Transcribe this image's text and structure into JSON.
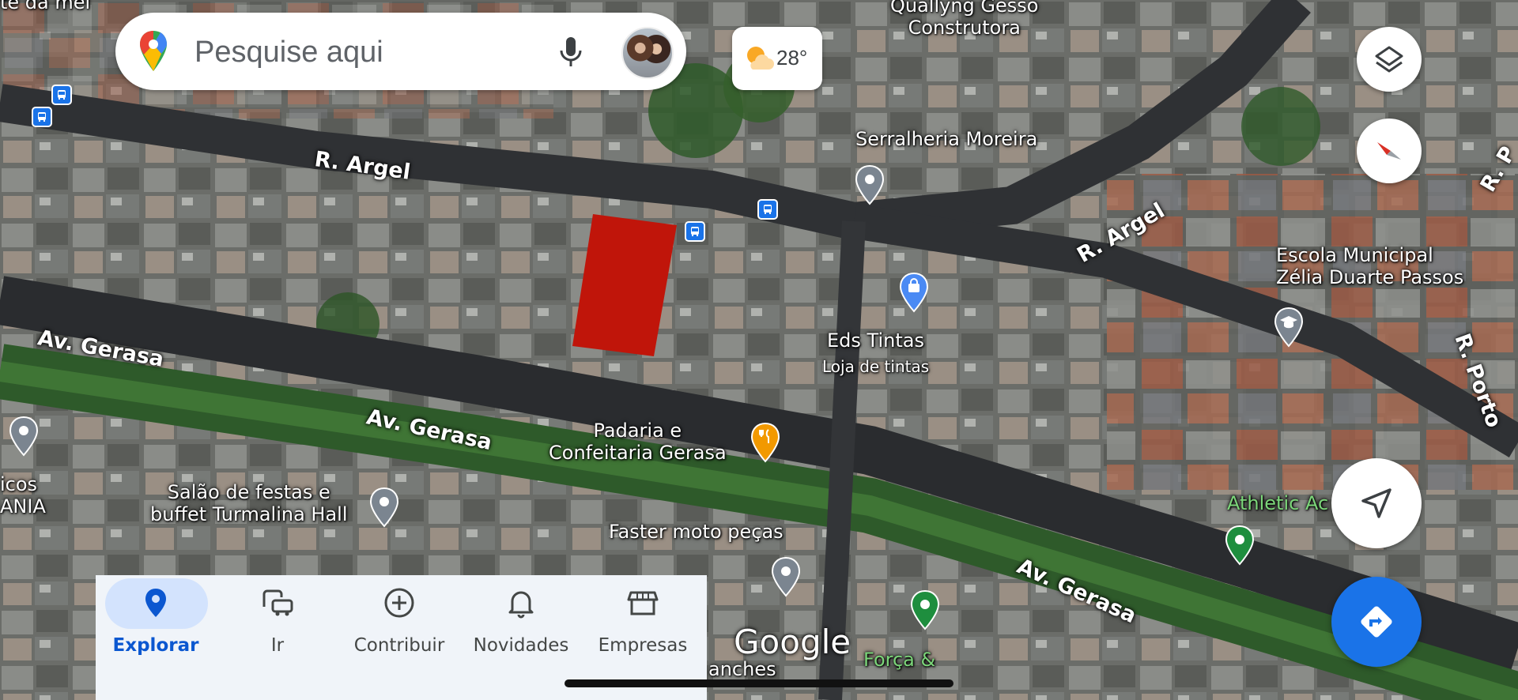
{
  "search": {
    "placeholder": "Pesquise aqui",
    "mic_icon": "mic-icon",
    "logo_icon": "maps-pin-logo-icon"
  },
  "weather": {
    "temperature": "28°",
    "icon": "partly-sunny-icon"
  },
  "streets": {
    "argel_left": "R. Argel",
    "argel_right": "R. Argel",
    "gerasa_left": "Av. Gerasa",
    "gerasa_mid": "Av. Gerasa",
    "gerasa_right": "Av. Gerasa",
    "r_porto": "R. Porto",
    "r_right": "R. P"
  },
  "places": {
    "qualyng_line1": "Quallyng Gesso",
    "qualyng_line2": "Construtora",
    "serralheria": "Serralheria Moreira",
    "escola_line1": "Escola Municipal",
    "escola_line2": "Zélia Duarte Passos",
    "eds_tintas": "Eds Tintas",
    "eds_tintas_sub": "Loja de tintas",
    "padaria_line1": "Padaria e",
    "padaria_line2": "Confeitaria Gerasa",
    "salao_line1": "Salão de festas e",
    "salao_line2": "buffet Turmalina Hall",
    "faster": "Faster moto peças",
    "athletic": "Athletic Ac",
    "forca": "Força &",
    "lanches": "anches",
    "left_cut_1": "icos",
    "left_cut_2": "ANIA",
    "top_left_cut": "te da mel"
  },
  "watermark": "Google",
  "bottom_nav": {
    "items": [
      {
        "label": "Explorar",
        "icon": "location-pin-icon",
        "active": true
      },
      {
        "label": "Ir",
        "icon": "commute-icon",
        "active": false
      },
      {
        "label": "Contribuir",
        "icon": "add-circle-icon",
        "active": false
      },
      {
        "label": "Novidades",
        "icon": "bell-icon",
        "active": false
      },
      {
        "label": "Empresas",
        "icon": "storefront-icon",
        "active": false
      }
    ]
  },
  "buttons": {
    "layers": "layers-icon",
    "compass": "compass-icon",
    "my_location": "navigation-arrow-icon",
    "directions": "directions-icon"
  },
  "colors": {
    "accent": "#1a73e8",
    "highlight_lot": "#c0150a",
    "active_pill": "#d3e3fd",
    "nav_bg": "#f0f4f9"
  }
}
